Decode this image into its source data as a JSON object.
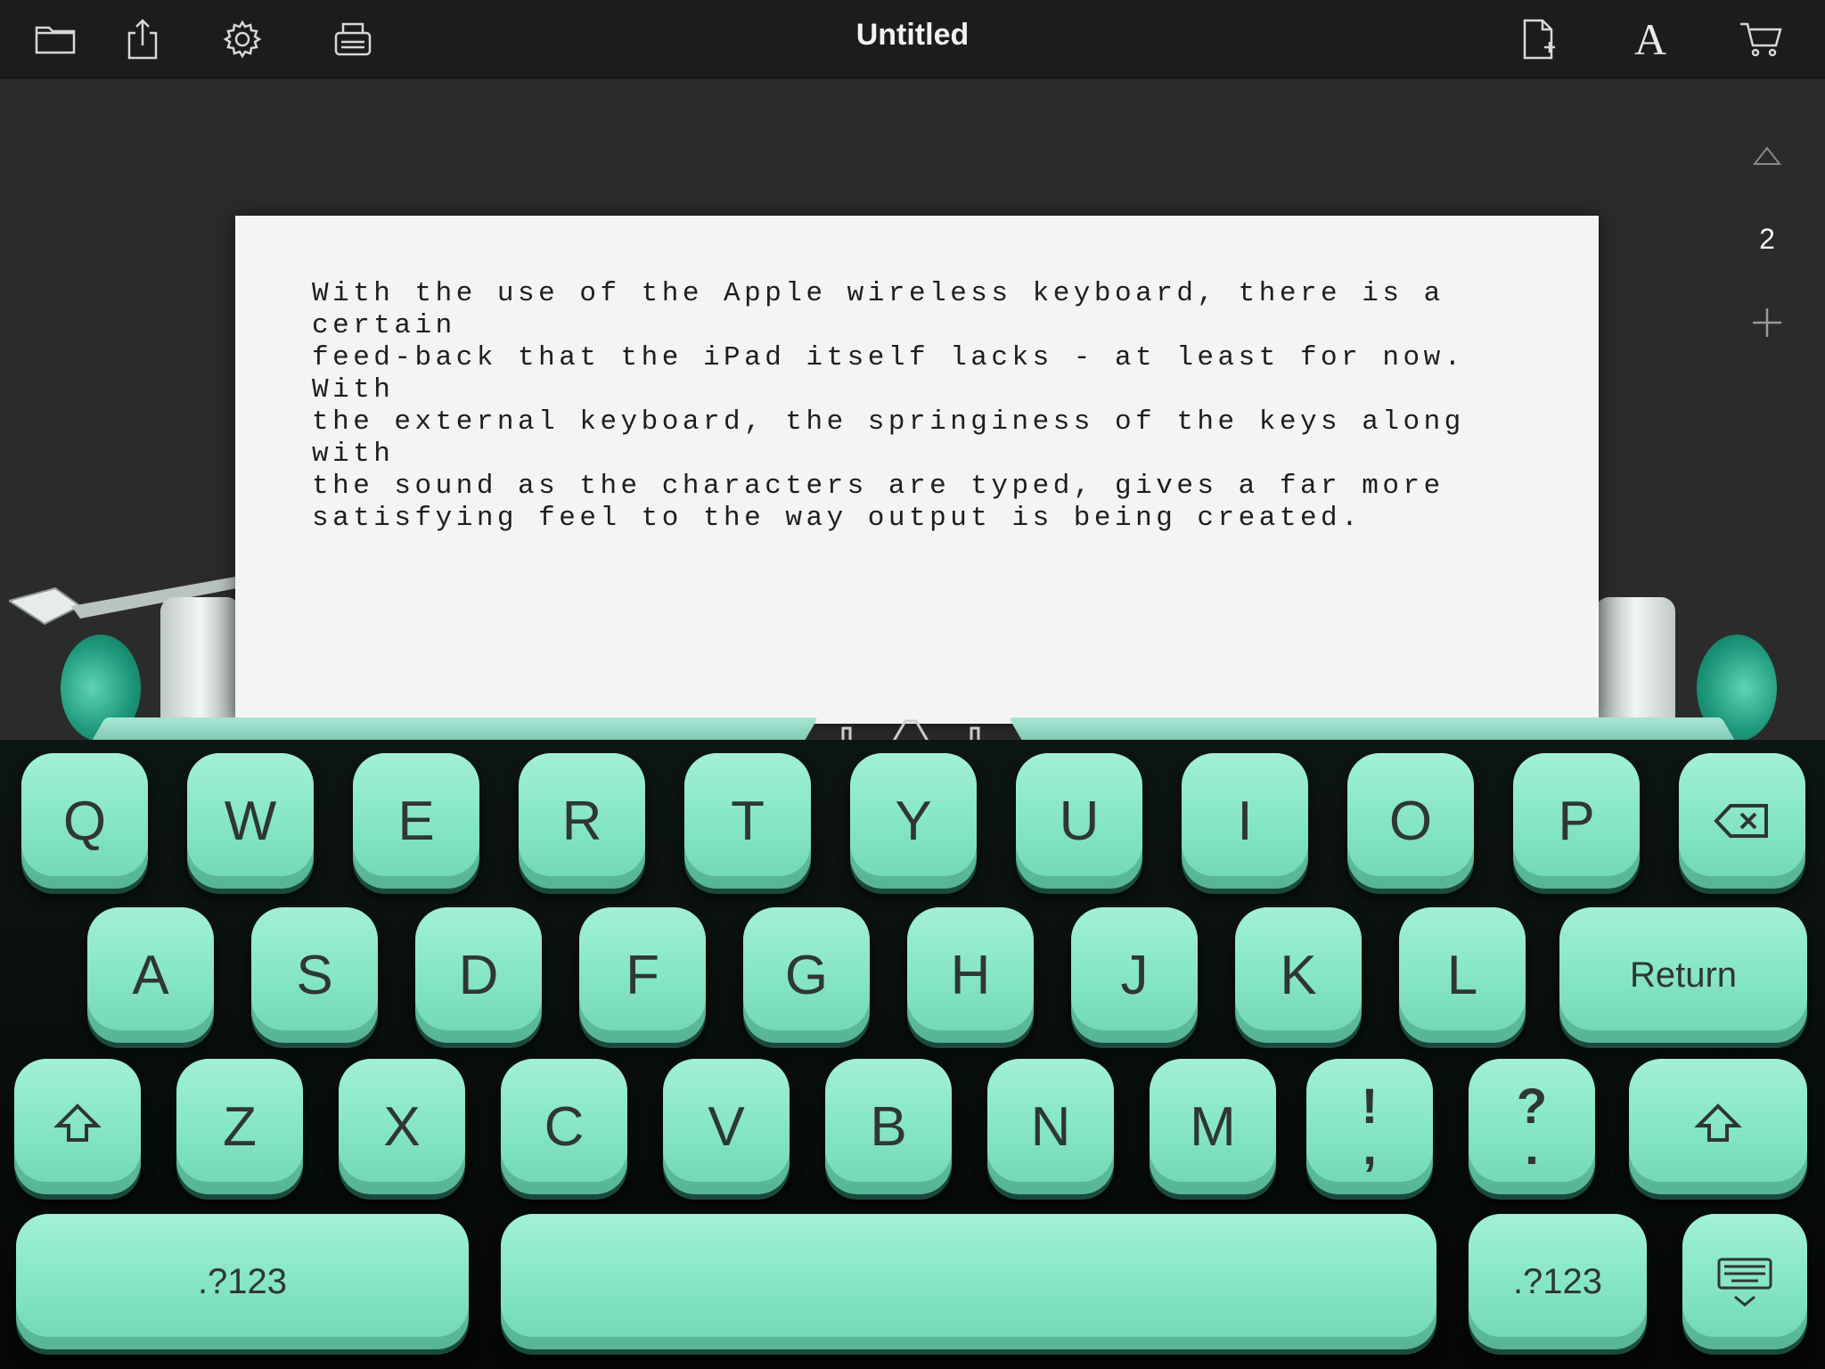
{
  "toolbar": {
    "title": "Untitled",
    "icons": [
      "folder-icon",
      "share-icon",
      "gear-icon",
      "typewriter-icon",
      "new-page-icon",
      "font-icon",
      "cart-icon"
    ],
    "font_glyph": "A"
  },
  "pager": {
    "current_page": "2"
  },
  "document": {
    "text": "With the use of the Apple wireless keyboard, there is a certain\nfeed-back that the iPad itself lacks - at least for now. With\nthe external keyboard, the springiness of the keys along with\nthe sound as the characters are typed, gives a far more\nsatisfying feel to the way output is being created."
  },
  "keyboard": {
    "row1": [
      "Q",
      "W",
      "E",
      "R",
      "T",
      "Y",
      "U",
      "I",
      "O",
      "P"
    ],
    "row2": [
      "A",
      "S",
      "D",
      "F",
      "G",
      "H",
      "J",
      "K",
      "L"
    ],
    "return_label": "Return",
    "row3": [
      "Z",
      "X",
      "C",
      "V",
      "B",
      "N",
      "M"
    ],
    "exclaim_key": "!\n,",
    "question_key": "?\n.",
    "numbers_label": ".?123",
    "colors": {
      "key": "#8fe8ca",
      "background": "#0a0f0d"
    }
  }
}
